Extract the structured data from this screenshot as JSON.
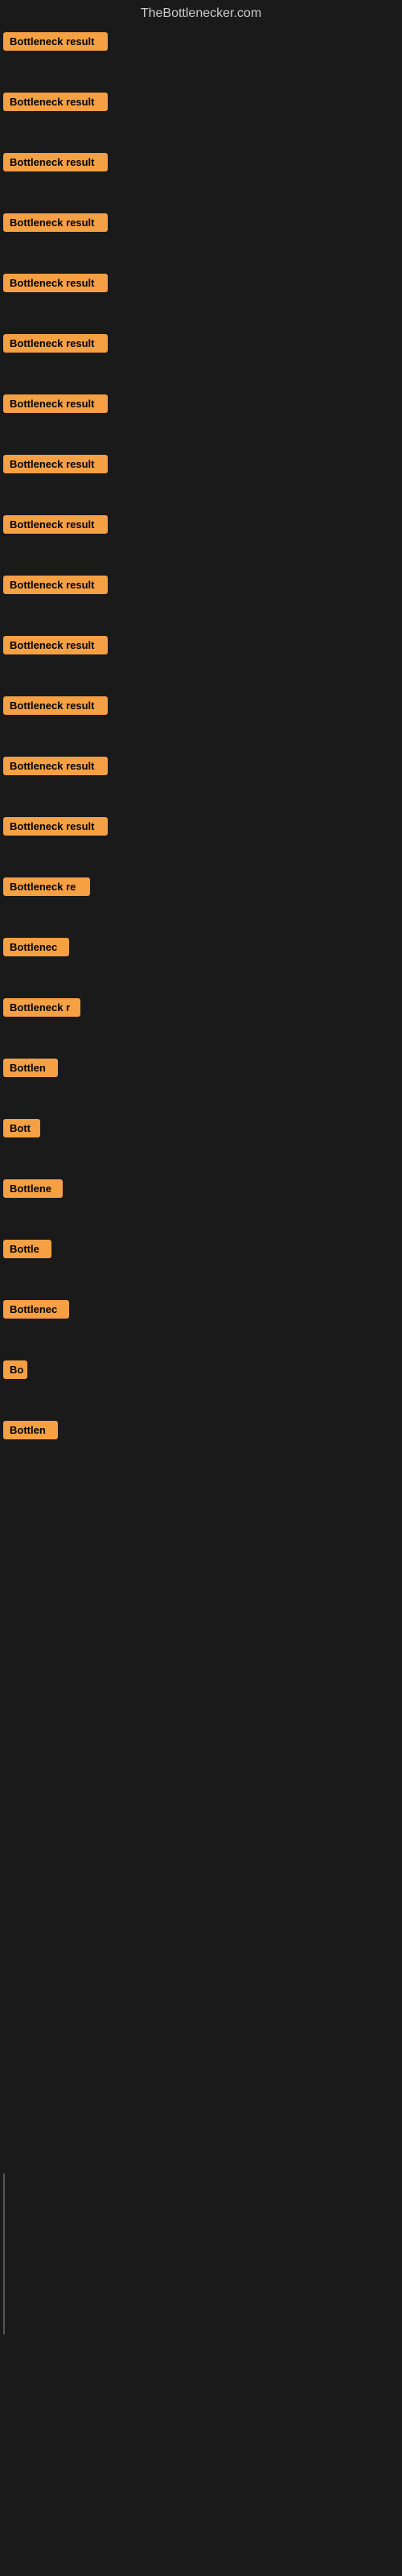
{
  "site": {
    "title": "TheBottlenecker.com"
  },
  "items": [
    {
      "id": 1,
      "label": "Bottleneck result",
      "width": 130
    },
    {
      "id": 2,
      "label": "Bottleneck result",
      "width": 130
    },
    {
      "id": 3,
      "label": "Bottleneck result",
      "width": 130
    },
    {
      "id": 4,
      "label": "Bottleneck result",
      "width": 130
    },
    {
      "id": 5,
      "label": "Bottleneck result",
      "width": 130
    },
    {
      "id": 6,
      "label": "Bottleneck result",
      "width": 130
    },
    {
      "id": 7,
      "label": "Bottleneck result",
      "width": 130
    },
    {
      "id": 8,
      "label": "Bottleneck result",
      "width": 130
    },
    {
      "id": 9,
      "label": "Bottleneck result",
      "width": 130
    },
    {
      "id": 10,
      "label": "Bottleneck result",
      "width": 130
    },
    {
      "id": 11,
      "label": "Bottleneck result",
      "width": 130
    },
    {
      "id": 12,
      "label": "Bottleneck result",
      "width": 130
    },
    {
      "id": 13,
      "label": "Bottleneck result",
      "width": 130
    },
    {
      "id": 14,
      "label": "Bottleneck result",
      "width": 130
    },
    {
      "id": 15,
      "label": "Bottleneck re",
      "width": 108
    },
    {
      "id": 16,
      "label": "Bottlenec",
      "width": 82
    },
    {
      "id": 17,
      "label": "Bottleneck r",
      "width": 96
    },
    {
      "id": 18,
      "label": "Bottlen",
      "width": 68
    },
    {
      "id": 19,
      "label": "Bott",
      "width": 46
    },
    {
      "id": 20,
      "label": "Bottlene",
      "width": 74
    },
    {
      "id": 21,
      "label": "Bottle",
      "width": 60
    },
    {
      "id": 22,
      "label": "Bottlenec",
      "width": 82
    },
    {
      "id": 23,
      "label": "Bo",
      "width": 30
    },
    {
      "id": 24,
      "label": "Bottlen",
      "width": 68
    }
  ],
  "colors": {
    "badge_bg": "#f5a043",
    "badge_text": "#000000",
    "background": "#1a1a1a",
    "title": "#cccccc"
  }
}
